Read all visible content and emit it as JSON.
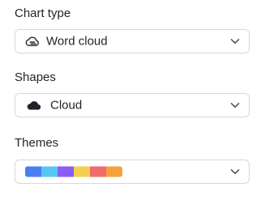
{
  "chart_type": {
    "label": "Chart type",
    "value": "Word cloud",
    "icon": "word-cloud-icon"
  },
  "shapes": {
    "label": "Shapes",
    "value": "Cloud",
    "icon": "cloud-icon"
  },
  "themes": {
    "label": "Themes",
    "swatches": [
      "#4a7ff3",
      "#55c7f2",
      "#8b5cf6",
      "#f6cf4d",
      "#f26b6b",
      "#f5a23c"
    ]
  },
  "colors": {
    "border": "#d4d7dc",
    "text": "#1f2329",
    "chevron": "#4d5259"
  }
}
